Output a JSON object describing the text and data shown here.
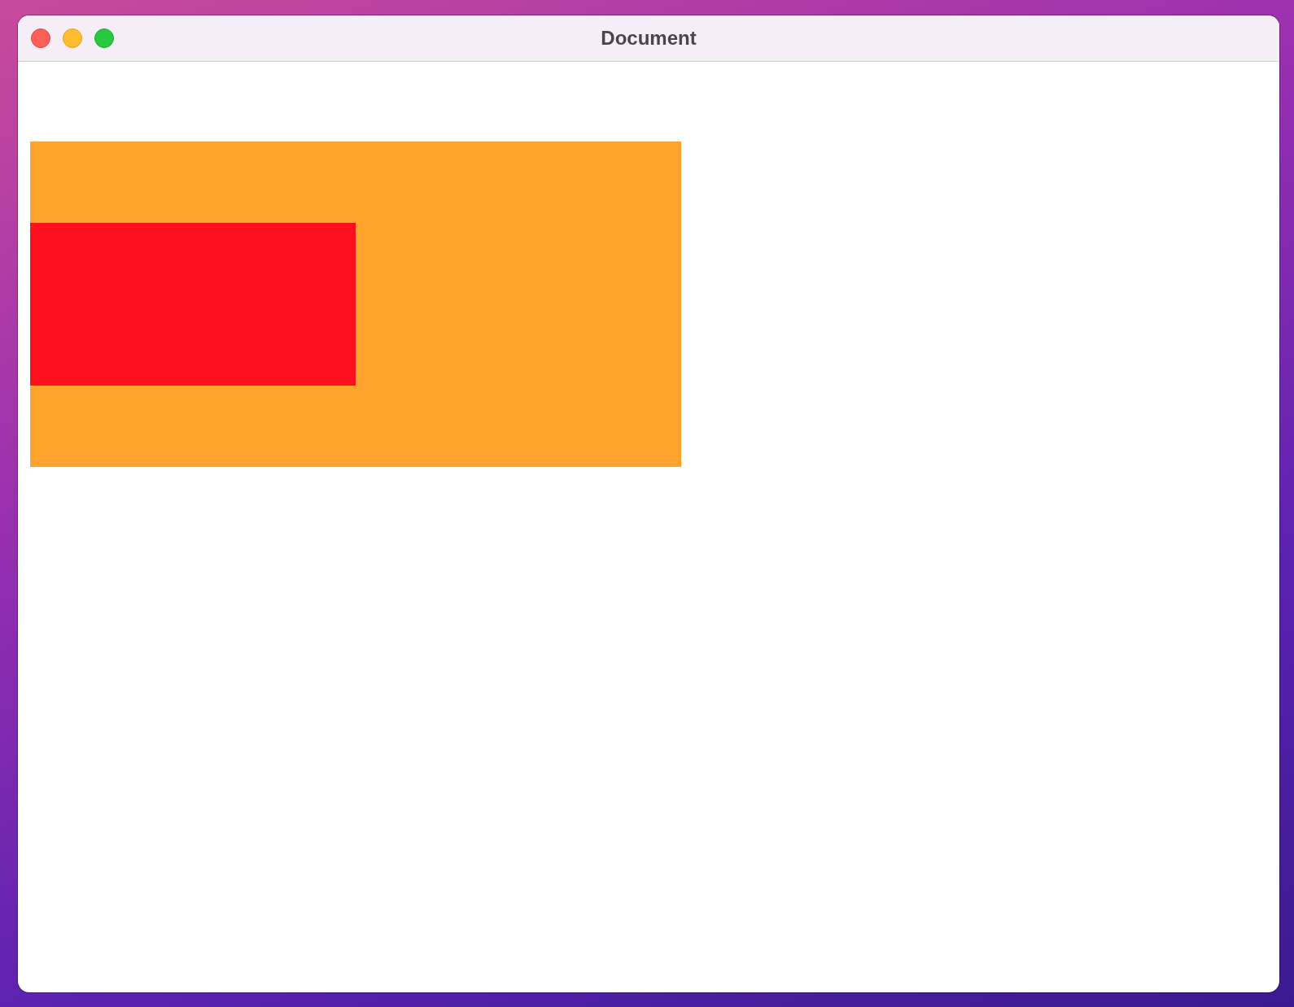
{
  "window": {
    "title": "Document"
  }
}
